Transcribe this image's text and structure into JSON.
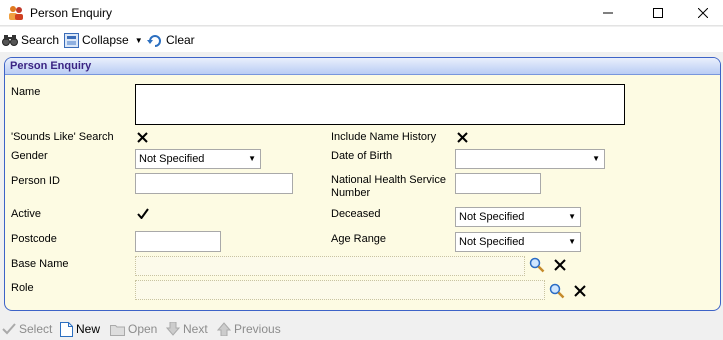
{
  "window": {
    "title": "Person Enquiry"
  },
  "toolbar": {
    "search_label": "Search",
    "collapse_label": "Collapse",
    "clear_label": "Clear"
  },
  "panel": {
    "title": "Person Enquiry"
  },
  "form": {
    "name_label": "Name",
    "sounds_like_label": "'Sounds Like' Search",
    "include_history_label": "Include Name History",
    "gender_label": "Gender",
    "gender_value": "Not Specified",
    "dob_label": "Date of Birth",
    "person_id_label": "Person ID",
    "nhs_label": "National Health Service Number",
    "active_label": "Active",
    "deceased_label": "Deceased",
    "deceased_value": "Not Specified",
    "postcode_label": "Postcode",
    "age_range_label": "Age Range",
    "age_range_value": "Not Specified",
    "base_name_label": "Base Name",
    "role_label": "Role",
    "sounds_like_checked": true,
    "include_history_checked": true,
    "active_checked": true
  },
  "footer": {
    "select_label": "Select",
    "new_label": "New",
    "open_label": "Open",
    "next_label": "Next",
    "previous_label": "Previous"
  }
}
